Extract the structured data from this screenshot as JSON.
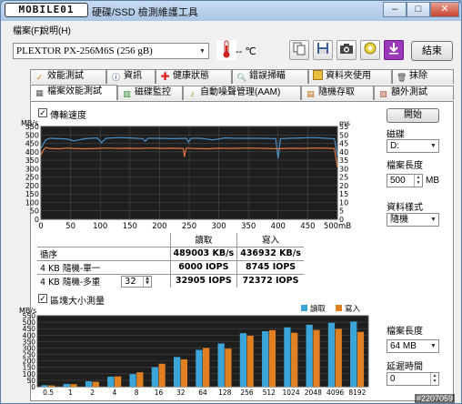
{
  "window": {
    "logo_text": "MOBILE01",
    "title": "硬碟/SSD 檢測維護工具",
    "minimize": "–",
    "maximize": "□",
    "close": "✕"
  },
  "menu": {
    "file": "檔案(F)",
    "help": "說明(H)"
  },
  "toolbar": {
    "device": "PLEXTOR PX-256M6S (256 gB)",
    "temperature": "-- ℃",
    "exit": "結束",
    "icons": [
      "thermometer-icon",
      "copy-icon",
      "save-icon",
      "camera-icon",
      "reload-icon",
      "download-icon"
    ]
  },
  "tabs_row1": [
    "效能測試",
    "資訊",
    "健康狀態",
    "錯誤掃瞄",
    "資料夾使用",
    "抹除"
  ],
  "tabs_row2": [
    "檔案效能測試",
    "磁碟監控",
    "自動噪聲管理(AAM)",
    "隨機存取",
    "額外測試"
  ],
  "transfer": {
    "label": "傳輸速度",
    "checked": true,
    "left_unit": "MB/s",
    "right_unit": "ms"
  },
  "controls": {
    "start": "開始",
    "drive_label": "磁碟",
    "drive_value": "D:",
    "file_len_label": "檔案長度",
    "file_len_value": "500",
    "file_len_unit": "MB",
    "pattern_label": "資料樣式",
    "pattern_value": "隨機",
    "block_len_label": "檔案長度",
    "block_len_value": "64 MB",
    "delay_label": "延遲時間",
    "delay_value": "0"
  },
  "results": {
    "header_read": "讀取",
    "header_write": "寫入",
    "rows": [
      {
        "name": "循序",
        "read": "489003 KB/s",
        "write": "436932 KB/s"
      },
      {
        "name": "4 KB 隨機-單一",
        "read": "6000 IOPS",
        "write": "8745 IOPS"
      },
      {
        "name": "4 KB 隨機-多重",
        "queue": "32",
        "read": "32905 IOPS",
        "write": "72372 IOPS"
      }
    ]
  },
  "block_test": {
    "label": "區塊大小測量",
    "checked": true,
    "unit": "MB/s",
    "legend_read": "讀取",
    "legend_write": "寫入"
  },
  "watermark": "#2207059",
  "chart_data": [
    {
      "type": "line",
      "title": "",
      "xlabel": "",
      "ylabel": "MB/s",
      "x_ticks": [
        "0",
        "50",
        "100",
        "150",
        "200",
        "250",
        "300",
        "350",
        "400",
        "450",
        "500mB"
      ],
      "xlim": [
        0,
        500
      ],
      "ylim": [
        0,
        550
      ],
      "y_ticks": [
        0,
        50,
        100,
        150,
        200,
        250,
        300,
        350,
        400,
        450,
        500,
        550
      ],
      "y2_ticks": [
        0,
        5,
        10,
        15,
        20,
        25,
        30,
        35,
        40,
        45,
        50,
        55
      ],
      "y2label": "ms",
      "grid": true,
      "series": [
        {
          "color": "#4a90c8",
          "x": [
            0,
            4,
            8,
            15,
            30,
            45,
            55,
            75,
            95,
            102,
            110,
            130,
            150,
            172,
            176,
            180,
            200,
            225,
            245,
            249,
            253,
            270,
            290,
            310,
            330,
            370,
            396,
            400,
            404,
            420,
            440,
            460,
            480,
            495,
            500
          ],
          "y": [
            420,
            445,
            470,
            480,
            478,
            475,
            465,
            478,
            482,
            455,
            480,
            484,
            482,
            478,
            462,
            480,
            480,
            478,
            480,
            458,
            480,
            480,
            470,
            482,
            480,
            480,
            478,
            360,
            478,
            480,
            482,
            484,
            480,
            478,
            380
          ]
        },
        {
          "color": "#e07840",
          "x": [
            0,
            4,
            8,
            15,
            30,
            45,
            55,
            75,
            95,
            110,
            130,
            150,
            165,
            185,
            205,
            220,
            240,
            242,
            245,
            255,
            280,
            300,
            320,
            350,
            380,
            400,
            420,
            440,
            460,
            480,
            495,
            500
          ],
          "y": [
            380,
            410,
            425,
            420,
            418,
            422,
            420,
            418,
            420,
            422,
            420,
            421,
            420,
            422,
            420,
            421,
            420,
            370,
            422,
            420,
            418,
            421,
            420,
            422,
            420,
            418,
            421,
            420,
            422,
            421,
            420,
            310
          ]
        }
      ]
    },
    {
      "type": "bar",
      "title": "",
      "ylabel": "MB/s",
      "categories": [
        "0.5",
        "1",
        "2",
        "4",
        "8",
        "16",
        "32",
        "64",
        "128",
        "256",
        "512",
        "1024",
        "2048",
        "4096",
        "8192"
      ],
      "ylim": [
        0,
        550
      ],
      "y_ticks": [
        0,
        50,
        100,
        150,
        200,
        250,
        300,
        350,
        400,
        450,
        500,
        550
      ],
      "grid": true,
      "series": [
        {
          "name": "讀取",
          "color": "#3ba4d8",
          "values": [
            12,
            22,
            42,
            78,
            98,
            152,
            230,
            285,
            335,
            415,
            430,
            460,
            480,
            495,
            505
          ]
        },
        {
          "name": "寫入",
          "color": "#e08020",
          "values": [
            10,
            20,
            38,
            80,
            112,
            178,
            212,
            300,
            295,
            395,
            438,
            418,
            440,
            448,
            425
          ]
        }
      ]
    }
  ]
}
